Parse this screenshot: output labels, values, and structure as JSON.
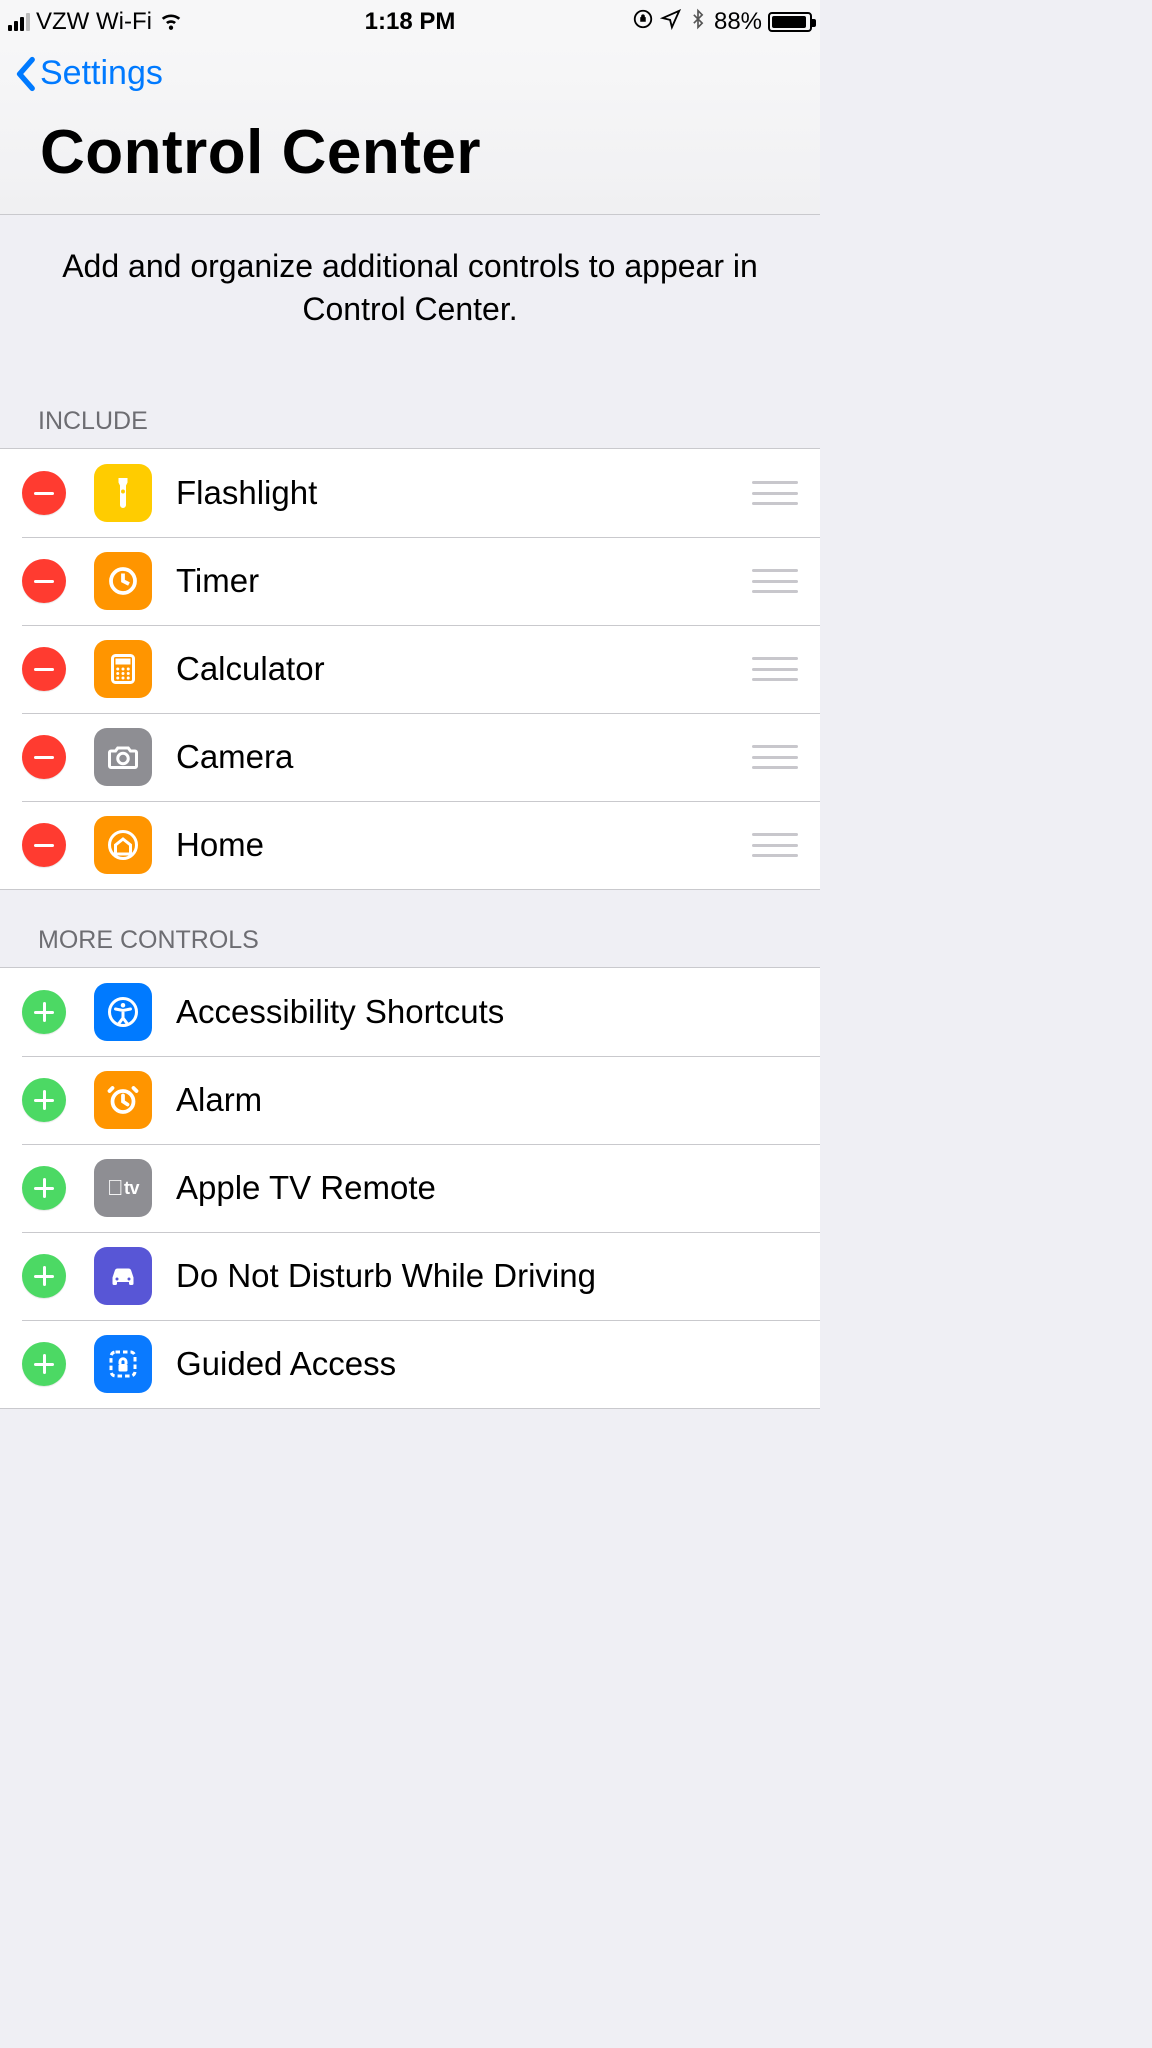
{
  "statusBar": {
    "carrier": "VZW Wi-Fi",
    "time": "1:18 PM",
    "battery": "88%"
  },
  "nav": {
    "back": "Settings",
    "title": "Control Center"
  },
  "description": "Add and organize additional controls to appear in Control Center.",
  "sections": {
    "include": {
      "header": "INCLUDE",
      "items": [
        {
          "label": "Flashlight",
          "icon": "flashlight-icon",
          "bg": "bg-yellow"
        },
        {
          "label": "Timer",
          "icon": "timer-icon",
          "bg": "bg-orange"
        },
        {
          "label": "Calculator",
          "icon": "calculator-icon",
          "bg": "bg-orange"
        },
        {
          "label": "Camera",
          "icon": "camera-icon",
          "bg": "bg-gray"
        },
        {
          "label": "Home",
          "icon": "home-icon",
          "bg": "bg-orange"
        }
      ]
    },
    "more": {
      "header": "MORE CONTROLS",
      "items": [
        {
          "label": "Accessibility Shortcuts",
          "icon": "accessibility-icon",
          "bg": "bg-blue"
        },
        {
          "label": "Alarm",
          "icon": "alarm-icon",
          "bg": "bg-orange"
        },
        {
          "label": "Apple TV Remote",
          "icon": "appletv-icon",
          "bg": "bg-gray"
        },
        {
          "label": "Do Not Disturb While Driving",
          "icon": "car-icon",
          "bg": "bg-purple"
        },
        {
          "label": "Guided Access",
          "icon": "lock-dashed-icon",
          "bg": "bg-dblue"
        }
      ]
    }
  }
}
